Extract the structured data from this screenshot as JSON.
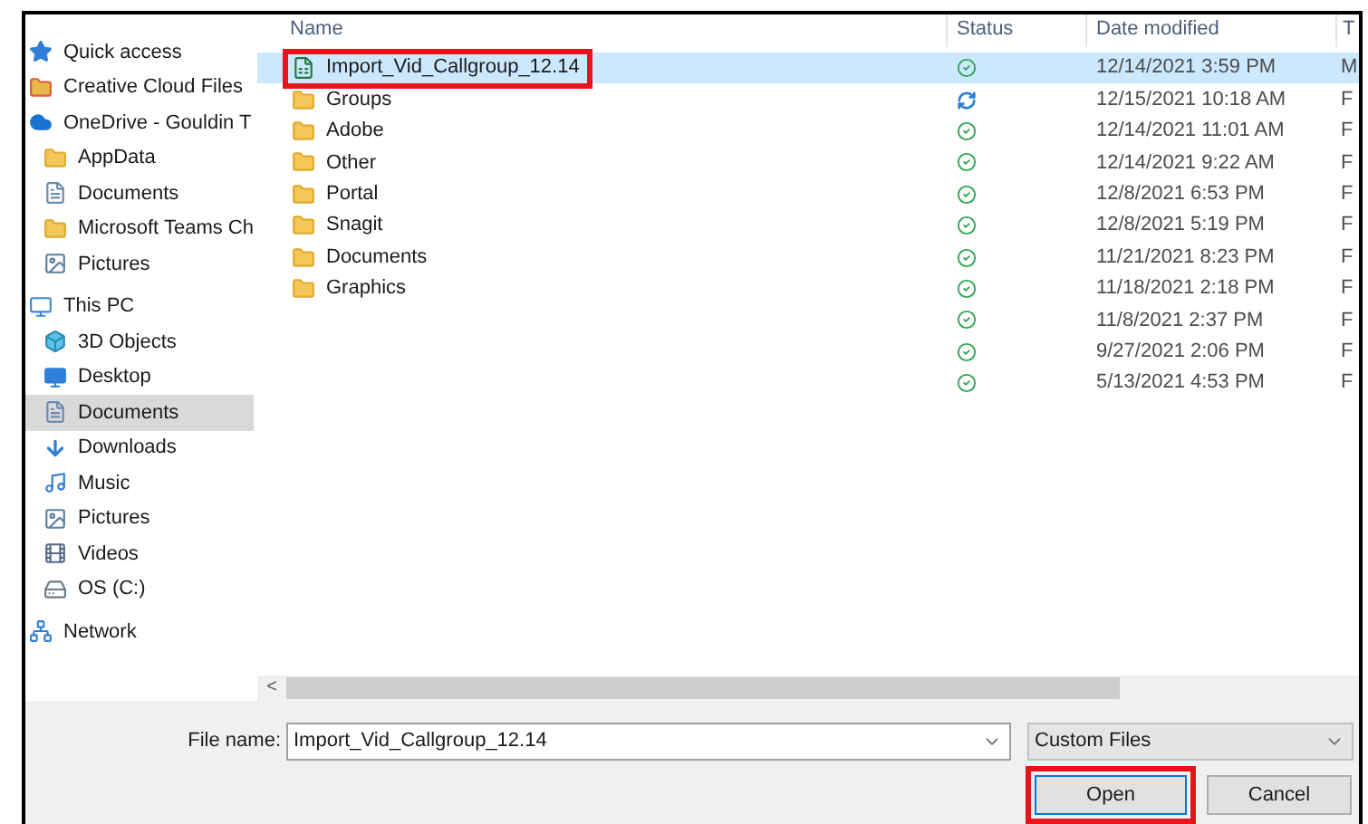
{
  "navigation": {
    "items": [
      {
        "label": "Quick access",
        "kind": "star",
        "selected": false
      },
      {
        "label": "Creative Cloud Files",
        "kind": "cloudfiles",
        "selected": false
      },
      {
        "label": "OneDrive - Gouldin T",
        "kind": "cloud",
        "selected": false,
        "children": [
          {
            "label": "AppData",
            "kind": "folder",
            "selected": false
          },
          {
            "label": "Documents",
            "kind": "document",
            "selected": false
          },
          {
            "label": "Microsoft Teams Ch",
            "kind": "folder",
            "selected": false
          },
          {
            "label": "Pictures",
            "kind": "pictures",
            "selected": false
          }
        ]
      },
      {
        "label": "This PC",
        "kind": "pc",
        "selected": false,
        "children": [
          {
            "label": "3D Objects",
            "kind": "cube",
            "selected": false
          },
          {
            "label": "Desktop",
            "kind": "desktop",
            "selected": false
          },
          {
            "label": "Documents",
            "kind": "document",
            "selected": true
          },
          {
            "label": "Downloads",
            "kind": "download",
            "selected": false
          },
          {
            "label": "Music",
            "kind": "music",
            "selected": false
          },
          {
            "label": "Pictures",
            "kind": "pictures",
            "selected": false
          },
          {
            "label": "Videos",
            "kind": "video",
            "selected": false
          },
          {
            "label": "OS (C:)",
            "kind": "drive",
            "selected": false
          }
        ]
      },
      {
        "label": "Network",
        "kind": "network",
        "selected": false
      }
    ]
  },
  "file_list": {
    "columns": [
      "Name",
      "Status",
      "Date modified",
      "T"
    ],
    "rows": [
      {
        "name": "Import_Vid_Callgroup_12.14",
        "kind": "spreadsheet",
        "synced": true,
        "date": "12/14/2021 3:59 PM",
        "column_4": "M",
        "selected": true,
        "highlighted": true
      },
      {
        "name": "Groups",
        "kind": "folder",
        "synced": false,
        "date": "12/15/2021 10:18 AM",
        "column_4": "F",
        "selected": false,
        "highlighted": false
      },
      {
        "name": "Adobe",
        "kind": "folder",
        "synced": true,
        "date": "12/14/2021 11:01 AM",
        "column_4": "F",
        "selected": false,
        "highlighted": false
      },
      {
        "name": "Other",
        "kind": "folder",
        "synced": true,
        "date": "12/14/2021 9:22 AM",
        "column_4": "F",
        "selected": false,
        "highlighted": false
      },
      {
        "name": "Portal",
        "kind": "folder",
        "synced": true,
        "date": "12/8/2021 6:53 PM",
        "column_4": "F",
        "selected": false,
        "highlighted": false
      },
      {
        "name": "Snagit",
        "kind": "folder",
        "synced": true,
        "date": "12/8/2021 5:19 PM",
        "column_4": "F",
        "selected": false,
        "highlighted": false
      },
      {
        "name": "Documents",
        "kind": "folder",
        "synced": true,
        "date": "11/21/2021 8:23 PM",
        "column_4": "F",
        "selected": false,
        "highlighted": false
      },
      {
        "name": "Graphics",
        "kind": "folder",
        "synced": true,
        "date": "11/18/2021 2:18 PM",
        "column_4": "F",
        "selected": false,
        "highlighted": false
      },
      {
        "synced": true,
        "date": "11/8/2021 2:37 PM",
        "column_4": "F",
        "selected": false
      },
      {
        "synced": true,
        "date": "9/27/2021 2:06 PM",
        "column_4": "F",
        "selected": false
      },
      {
        "synced": true,
        "date": "5/13/2021 4:53 PM",
        "column_4": "F",
        "selected": false
      }
    ]
  },
  "scrollbar_arrow": "<",
  "file_name": {
    "label": "File name:",
    "value": "Import_Vid_Callgroup_12.14"
  },
  "file_type": {
    "value": "Custom Files"
  },
  "buttons": [
    {
      "label": "Open",
      "kind": "primary",
      "highlighted": true
    },
    {
      "label": "Cancel",
      "kind": "secondary",
      "highlighted": false
    }
  ]
}
